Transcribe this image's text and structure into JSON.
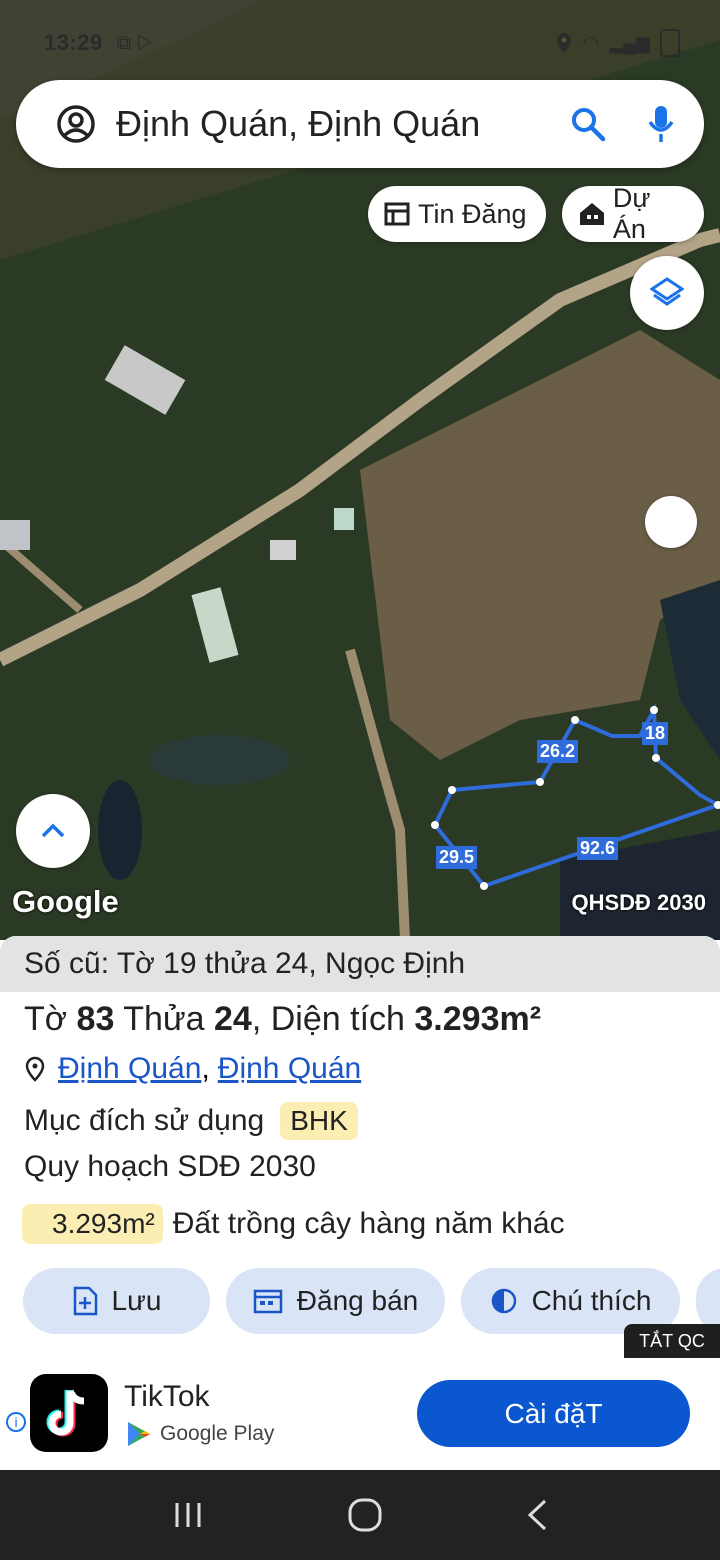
{
  "status_bar": {
    "time": "13:29"
  },
  "search": {
    "query": "Định Quán, Định Quán"
  },
  "chips": {
    "listings": "Tin Đăng",
    "projects": "Dự Án"
  },
  "map": {
    "attribution": "Google",
    "layer_label": "QHSDĐ 2030",
    "edge_labels": [
      "26.2",
      "18",
      "29.5",
      "92.6"
    ]
  },
  "parcel": {
    "old_number": "Số cũ: Tờ 19 thửa 24, Ngọc Định",
    "to_label": "Tờ",
    "sheet_no": "83",
    "thua_label": "Thửa",
    "parcel_no": "24",
    "area_label": "Diện tích",
    "area": "3.293m²",
    "location_1": "Định Quán",
    "location_sep": ",",
    "location_2": "Định Quán",
    "purpose_label": "Mục đích sử dụng",
    "purpose_code": "BHK",
    "plan_label": "Quy hoạch SDĐ 2030",
    "plan_area": "3.293m²",
    "plan_type": "Đất trồng cây hàng năm khác"
  },
  "actions": {
    "save": "Lưu",
    "post_sale": "Đăng bán",
    "legend": "Chú thích"
  },
  "ad": {
    "close_label": "TẮT QC",
    "app_name": "TikTok",
    "store": "Google Play",
    "install": "Cài đặT"
  },
  "colors": {
    "accent": "#0b57d0",
    "parcel_line": "#2f6cdb",
    "badge": "#fcedb3",
    "action_bg": "#d9e4f6"
  }
}
